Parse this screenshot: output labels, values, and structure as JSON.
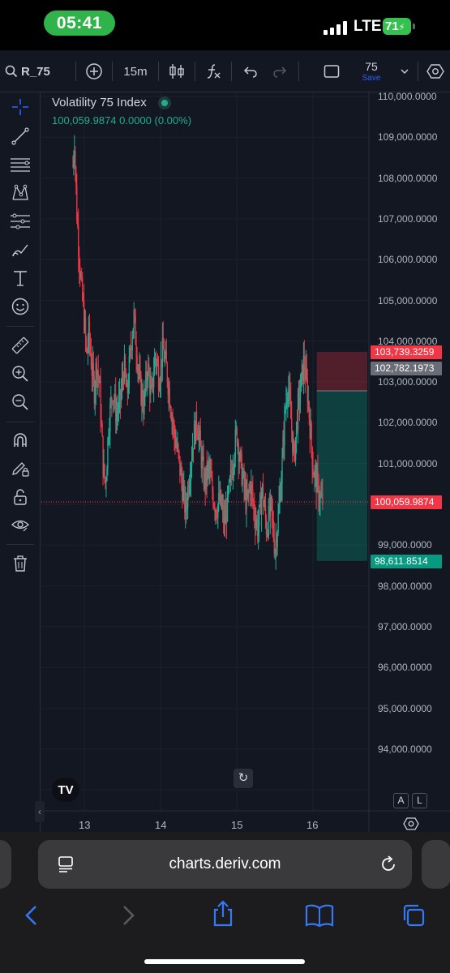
{
  "status_bar": {
    "time": "05:41",
    "network": "LTE",
    "battery": "71"
  },
  "toolbar": {
    "symbol": "R_75",
    "interval": "15m",
    "layout_count": "75",
    "save_label": "Save"
  },
  "legend": {
    "title": "Volatility 75 Index",
    "values": "100,059.9874  0.0000 (0.00%)"
  },
  "price_axis": {
    "labels": [
      "110,000.0000",
      "109,000.0000",
      "108,000.0000",
      "107,000.0000",
      "106,000.0000",
      "105,000.0000",
      "104,000.0000",
      "103,000.0000",
      "102,000.0000",
      "101,000.0000",
      "100,000.0000",
      "99,000.0000",
      "98,000.0000",
      "97,000.0000",
      "96,000.0000",
      "95,000.0000",
      "94,000.0000"
    ]
  },
  "price_tags": {
    "stop_loss": "103,739.3259",
    "entry": "102,782.1973",
    "current": "100,059.9874",
    "take_profit": "98,611.8514"
  },
  "time_axis": [
    "13",
    "14",
    "15",
    "16"
  ],
  "chart_controls": {
    "auto_label": "A",
    "log_label": "L",
    "logo_text": "TV"
  },
  "browser": {
    "url": "charts.deriv.com"
  },
  "colors": {
    "up": "#22ab94",
    "down": "#f23645",
    "background": "#131722",
    "accent": "#2962ff"
  },
  "chart_data": {
    "type": "candlestick",
    "title": "Volatility 75 Index",
    "interval": "15m",
    "ylim": [
      93000,
      110000
    ],
    "x_ticks": [
      "13",
      "14",
      "15",
      "16"
    ],
    "last_price": 100059.9874,
    "position": {
      "type": "short",
      "entry": 102782.1973,
      "stop_loss": 103739.3259,
      "take_profit": 98611.8514
    },
    "close_path": [
      [
        12.85,
        108300
      ],
      [
        12.87,
        109000
      ],
      [
        12.9,
        107200
      ],
      [
        12.93,
        106200
      ],
      [
        12.96,
        105300
      ],
      [
        13.0,
        104500
      ],
      [
        13.03,
        103600
      ],
      [
        13.06,
        104200
      ],
      [
        13.1,
        103300
      ],
      [
        13.13,
        102800
      ],
      [
        13.16,
        103500
      ],
      [
        13.2,
        102900
      ],
      [
        13.25,
        100800
      ],
      [
        13.28,
        100500
      ],
      [
        13.32,
        102000
      ],
      [
        13.37,
        102800
      ],
      [
        13.42,
        102200
      ],
      [
        13.47,
        102500
      ],
      [
        13.52,
        103400
      ],
      [
        13.56,
        102600
      ],
      [
        13.61,
        103900
      ],
      [
        13.65,
        104600
      ],
      [
        13.69,
        103700
      ],
      [
        13.73,
        102900
      ],
      [
        13.78,
        102400
      ],
      [
        13.83,
        103400
      ],
      [
        13.88,
        102600
      ],
      [
        13.93,
        103700
      ],
      [
        13.98,
        103100
      ],
      [
        14.03,
        103800
      ],
      [
        14.08,
        103300
      ],
      [
        14.13,
        102500
      ],
      [
        14.18,
        101700
      ],
      [
        14.23,
        101200
      ],
      [
        14.28,
        100500
      ],
      [
        14.33,
        99800
      ],
      [
        14.38,
        100800
      ],
      [
        14.43,
        101600
      ],
      [
        14.48,
        102100
      ],
      [
        14.53,
        101200
      ],
      [
        14.58,
        100500
      ],
      [
        14.63,
        100900
      ],
      [
        14.68,
        100300
      ],
      [
        14.73,
        99900
      ],
      [
        14.78,
        100100
      ],
      [
        14.84,
        99500
      ],
      [
        14.9,
        100300
      ],
      [
        14.95,
        101100
      ],
      [
        15.0,
        101800
      ],
      [
        15.04,
        101100
      ],
      [
        15.08,
        100600
      ],
      [
        15.13,
        100000
      ],
      [
        15.18,
        100500
      ],
      [
        15.23,
        99800
      ],
      [
        15.28,
        99400
      ],
      [
        15.33,
        100400
      ],
      [
        15.39,
        99400
      ],
      [
        15.45,
        99900
      ],
      [
        15.5,
        98900
      ],
      [
        15.54,
        99600
      ],
      [
        15.59,
        100800
      ],
      [
        15.63,
        102200
      ],
      [
        15.67,
        103000
      ],
      [
        15.71,
        102100
      ],
      [
        15.75,
        101100
      ],
      [
        15.8,
        102300
      ],
      [
        15.84,
        102900
      ],
      [
        15.88,
        103500
      ],
      [
        15.93,
        102700
      ],
      [
        15.97,
        101700
      ],
      [
        16.0,
        100900
      ],
      [
        16.05,
        100500
      ],
      [
        16.1,
        100100
      ],
      [
        16.13,
        100060
      ]
    ]
  }
}
